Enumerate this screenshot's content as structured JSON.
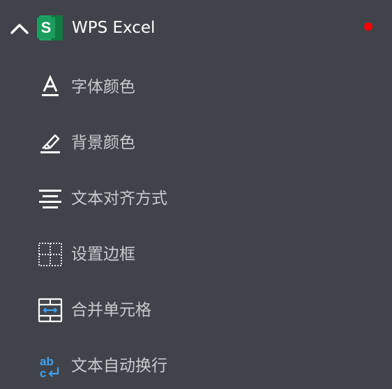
{
  "header": {
    "title": "WPS Excel",
    "app_icon_letter": "S",
    "collapse_icon": "chevron-up-icon",
    "notification": "red-dot-indicator",
    "colors": {
      "background": "#404349",
      "app_icon_green": "#1a9d5e",
      "notification_dot": "#ff0000"
    }
  },
  "menu": {
    "items": [
      {
        "label": "字体颜色",
        "icon": "font-color-icon"
      },
      {
        "label": "背景颜色",
        "icon": "highlighter-icon"
      },
      {
        "label": "文本对齐方式",
        "icon": "align-center-icon"
      },
      {
        "label": "设置边框",
        "icon": "border-grid-icon"
      },
      {
        "label": "合并单元格",
        "icon": "merge-cells-icon",
        "icon_text": ""
      },
      {
        "label": "文本自动换行",
        "icon": "wrap-text-icon",
        "icon_text": "abc"
      }
    ]
  }
}
